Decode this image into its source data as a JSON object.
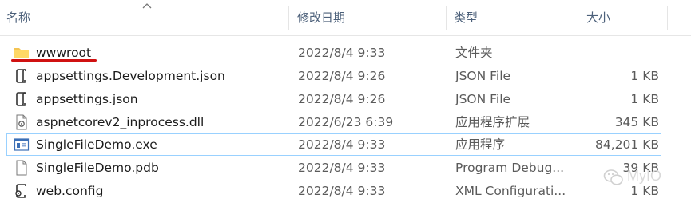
{
  "header": {
    "columns": {
      "name": "名称",
      "date": "修改日期",
      "type": "类型",
      "size": "大小"
    },
    "sort_icon": "chevron-up-icon"
  },
  "files": [
    {
      "name": "wwwroot",
      "date": "2022/8/4 9:33",
      "type": "文件夹",
      "size": "",
      "icon": "folder-icon"
    },
    {
      "name": "appsettings.Development.json",
      "date": "2022/8/4 9:26",
      "type": "JSON File",
      "size": "1 KB",
      "icon": "json-file-icon"
    },
    {
      "name": "appsettings.json",
      "date": "2022/8/4 9:26",
      "type": "JSON File",
      "size": "1 KB",
      "icon": "json-file-icon"
    },
    {
      "name": "aspnetcorev2_inprocess.dll",
      "date": "2022/6/23 6:39",
      "type": "应用程序扩展",
      "size": "345 KB",
      "icon": "dll-file-icon"
    },
    {
      "name": "SingleFileDemo.exe",
      "date": "2022/8/4 9:33",
      "type": "应用程序",
      "size": "84,201 KB",
      "icon": "exe-file-icon"
    },
    {
      "name": "SingleFileDemo.pdb",
      "date": "2022/8/4 9:33",
      "type": "Program Debug...",
      "size": "39 KB",
      "icon": "pdb-file-icon"
    },
    {
      "name": "web.config",
      "date": "2022/8/4 9:33",
      "type": "XML Configurati...",
      "size": "1 KB",
      "icon": "config-file-icon"
    }
  ],
  "selected_row": 4,
  "annotation_color": "#d01111",
  "watermark": {
    "text": "MyIO",
    "icon": "wechat-logo-icon"
  }
}
